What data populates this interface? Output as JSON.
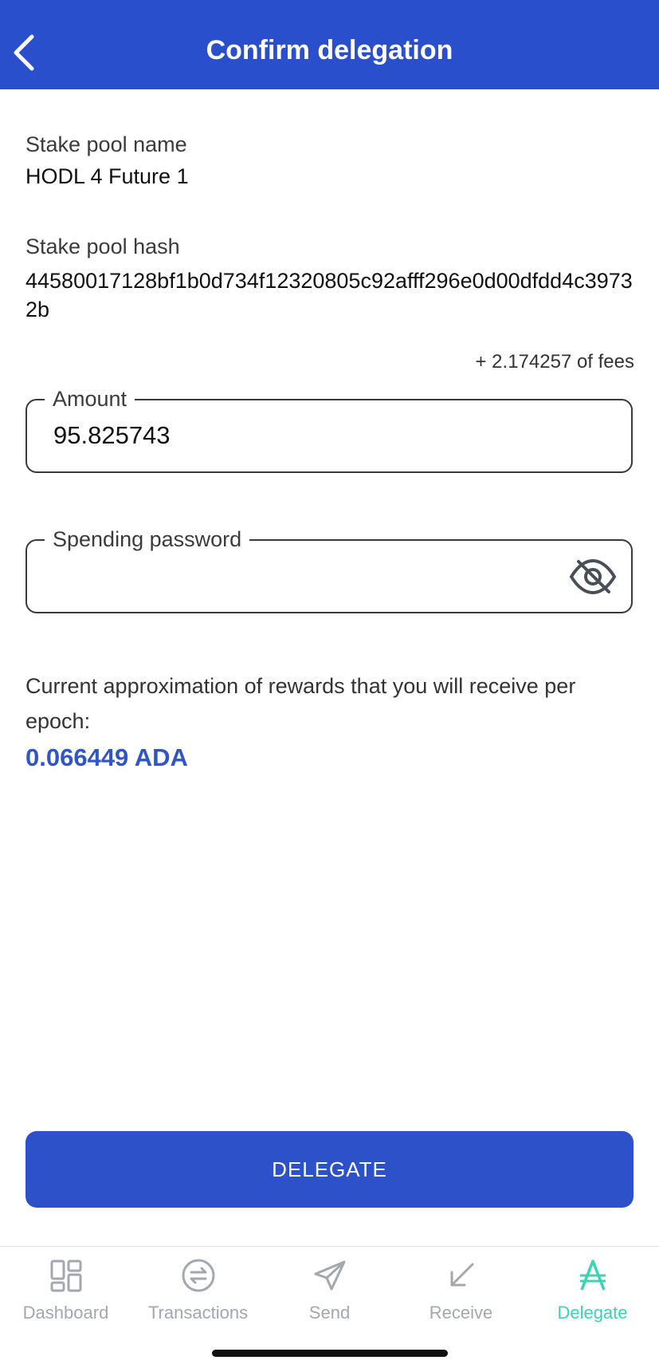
{
  "header": {
    "title": "Confirm delegation"
  },
  "stake_pool": {
    "name_label": "Stake pool name",
    "name": "HODL 4 Future 1",
    "hash_label": "Stake pool hash",
    "hash": "44580017128bf1b0d734f12320805c92afff296e0d00dfdd4c39732b"
  },
  "fees_text": "+ 2.174257 of fees",
  "amount": {
    "label": "Amount",
    "value": "95.825743"
  },
  "password": {
    "label": "Spending password",
    "value": ""
  },
  "rewards": {
    "text": "Current approximation of rewards that you will receive per epoch:",
    "value": "0.066449 ADA"
  },
  "delegate_button": {
    "label": "DELEGATE"
  },
  "tabs": [
    {
      "label": "Dashboard",
      "icon": "dashboard-icon"
    },
    {
      "label": "Transactions",
      "icon": "transactions-icon"
    },
    {
      "label": "Send",
      "icon": "send-icon"
    },
    {
      "label": "Receive",
      "icon": "receive-icon"
    },
    {
      "label": "Delegate",
      "icon": "ada-icon",
      "active": true
    }
  ],
  "colors": {
    "header_bg": "#2a4fcc",
    "button_bg": "#2d51c9",
    "reward_text": "#2f55c6",
    "tab_active": "#3ad4b2",
    "tab_inactive": "#a4a7ae"
  }
}
